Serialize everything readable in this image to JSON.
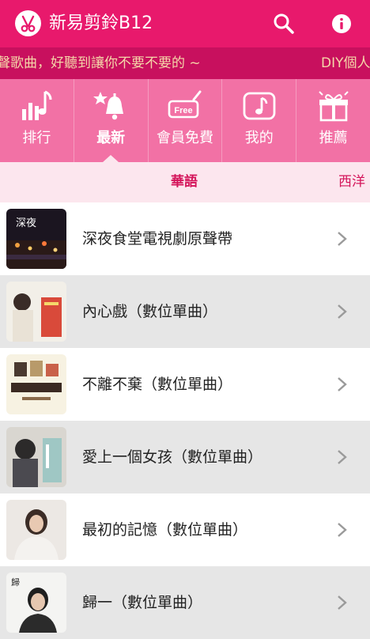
{
  "app": {
    "title": "新易剪鈴B12"
  },
  "marquee": {
    "text_left": "聲歌曲，好聽到讓你不要不要的 ~",
    "text_right": "DIY個人"
  },
  "categories": [
    {
      "label": "排行",
      "icon": "ranking-icon"
    },
    {
      "label": "最新",
      "icon": "new-bell-icon"
    },
    {
      "label": "會員免費",
      "icon": "free-tag-icon"
    },
    {
      "label": "我的",
      "icon": "my-music-icon"
    },
    {
      "label": "推薦",
      "icon": "gift-icon"
    }
  ],
  "subtabs": [
    {
      "label": "華語"
    },
    {
      "label": "西洋"
    }
  ],
  "list": [
    {
      "title": "深夜食堂電視劇原聲帶"
    },
    {
      "title": "內心戲（數位單曲）"
    },
    {
      "title": "不離不棄（數位單曲）"
    },
    {
      "title": "愛上一個女孩（數位單曲）"
    },
    {
      "title": "最初的記憶（數位單曲）"
    },
    {
      "title": "歸一（數位單曲）"
    }
  ],
  "colors": {
    "primary": "#e8196c",
    "marquee_bg": "#c8105e",
    "tabs_bg": "#f271a5",
    "subtab_bg": "#fce6ee",
    "accent_text": "#d4145a"
  }
}
